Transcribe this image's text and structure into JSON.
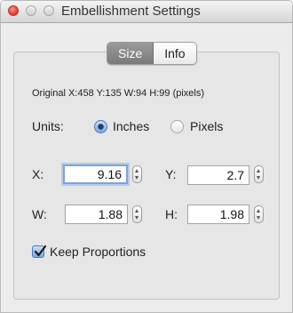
{
  "window": {
    "title": "Embellishment Settings"
  },
  "tabs": {
    "size": "Size",
    "info": "Info"
  },
  "original": {
    "text": "Original  X:458 Y:135  W:94 H:99 (pixels)"
  },
  "units": {
    "label": "Units:",
    "inches": "Inches",
    "pixels": "Pixels",
    "selected": "Inches"
  },
  "fields": {
    "x": {
      "label": "X:",
      "value": "9.16"
    },
    "y": {
      "label": "Y:",
      "value": "2.7"
    },
    "w": {
      "label": "W:",
      "value": "1.88"
    },
    "h": {
      "label": "H:",
      "value": "1.98"
    }
  },
  "keep_proportions": {
    "label": "Keep Proportions",
    "checked": true
  }
}
